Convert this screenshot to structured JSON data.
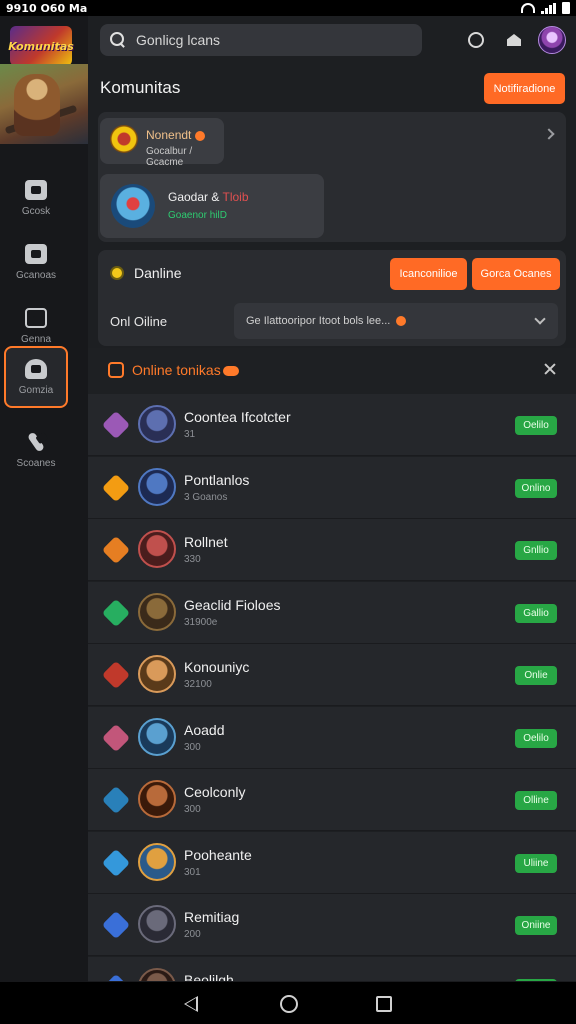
{
  "status_bar": {
    "time": "9910 O60 Ma"
  },
  "sidebar": {
    "logo_text": "Komunitas",
    "items": [
      {
        "label": "Gcosk",
        "icon": "game-icon"
      },
      {
        "label": "Gcanoas",
        "icon": "controller-icon"
      },
      {
        "label": "Genna",
        "icon": "chat-icon"
      },
      {
        "label": "Gomzia",
        "icon": "community-icon",
        "active": true
      },
      {
        "label": "Scoanes",
        "icon": "tools-icon"
      }
    ]
  },
  "header": {
    "search_value": "Gonlicg lcans",
    "title": "Komunitas",
    "notif_button": "Notifiradione"
  },
  "communities": [
    {
      "name": "Nonendt",
      "sub": "Gocalbur / Gcacme"
    },
    {
      "name": "Gaodar & ",
      "name_extra": "Tloib",
      "sub": "Goaenor hilD"
    }
  ],
  "online_panel": {
    "title": "Danline",
    "btn1": "Icanconilioe",
    "btn2": "Gorca Ocanes",
    "only_online_label": "Onl Oiline",
    "filter_value": "Ge Ilattooripor Itoot bols lee..."
  },
  "online_list": {
    "title": "Online tonikas",
    "rows": [
      {
        "name": "Coontea Ifcotcter",
        "sub": "31",
        "status": "Oelilo",
        "rank_color": "#9b59b6",
        "avatar": [
          "#5d6fb0",
          "#2a2f55"
        ]
      },
      {
        "name": "Pontlanlos",
        "sub": "3 Goanos",
        "status": "Onlino",
        "rank_color": "#f39c12",
        "avatar": [
          "#4f78c2",
          "#1d2a52"
        ]
      },
      {
        "name": "Rollnet",
        "sub": "330",
        "status": "Gnllio",
        "rank_color": "#e67e22",
        "avatar": [
          "#c0504d",
          "#4a1d1d"
        ]
      },
      {
        "name": "Geaclid Fioloes",
        "sub": "31900e",
        "status": "Gallio",
        "rank_color": "#27ae60",
        "avatar": [
          "#8a6a3a",
          "#3a2a1a"
        ]
      },
      {
        "name": "Konouniyc",
        "sub": "32100",
        "status": "Onlie",
        "rank_color": "#c0392b",
        "avatar": [
          "#d99a5a",
          "#5a3a1a"
        ]
      },
      {
        "name": "Aoadd",
        "sub": "300",
        "status": "Oelilo",
        "rank_color": "#c2567a",
        "avatar": [
          "#5aa0d0",
          "#1a3a5a"
        ]
      },
      {
        "name": "Ceolconly",
        "sub": "300",
        "status": "Olline",
        "rank_color": "#2980b9",
        "avatar": [
          "#b86a3a",
          "#3a1a0a"
        ]
      },
      {
        "name": "Pooheante",
        "sub": "301",
        "status": "Uliine",
        "rank_color": "#3498db",
        "avatar": [
          "#e0a040",
          "#2a5a8a"
        ]
      },
      {
        "name": "Remitiag",
        "sub": "200",
        "status": "Oniine",
        "rank_color": "#3a6fd8",
        "avatar": [
          "#6a6a7a",
          "#2a2a35"
        ]
      },
      {
        "name": "Beolilgh",
        "sub": "",
        "status": "Online",
        "rank_color": "#3a6fd8",
        "avatar": [
          "#7a5a4a",
          "#2a1a15"
        ]
      }
    ]
  },
  "colors": {
    "accent": "#ff6a25",
    "online_green": "#28a745",
    "background": "#1d1f22"
  }
}
